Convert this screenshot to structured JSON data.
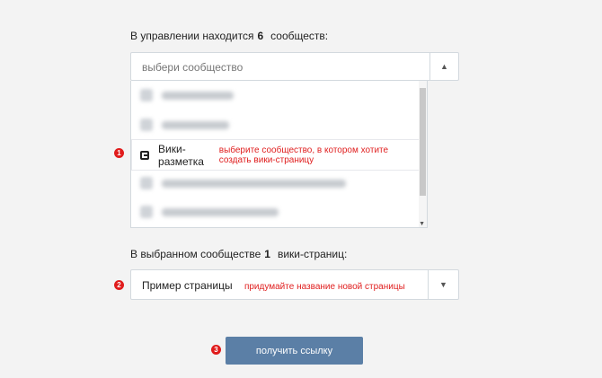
{
  "communities": {
    "label_prefix": "В управлении находится",
    "count": "6",
    "label_suffix": "сообществ:",
    "select_placeholder": "выбери сообщество",
    "active_item": "Вики-разметка",
    "hint": "выберите сообщество, в котором хотите создать вики-страницу"
  },
  "pages": {
    "label_prefix": "В выбранном сообществе",
    "count": "1",
    "label_suffix": "вики-страниц:",
    "selected": "Пример страницы",
    "hint": "придумайте название новой страницы"
  },
  "button": {
    "label": "получить ссылку"
  },
  "steps": [
    "1",
    "2",
    "3"
  ],
  "icons": {
    "select_open": "triangle-up-icon",
    "select_closed": "triangle-down-icon",
    "community": "community-icon"
  },
  "colors": {
    "hint": "#e02020",
    "step_badge": "#e01b1b",
    "button": "#5b7fa6"
  }
}
